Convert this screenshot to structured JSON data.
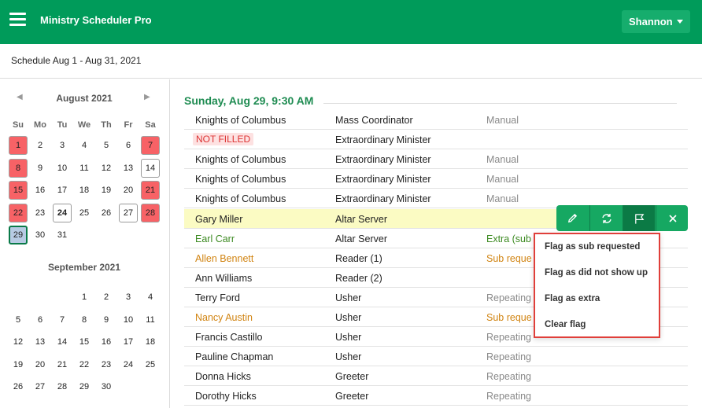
{
  "app": {
    "title": "Ministry Scheduler Pro",
    "user": "Shannon"
  },
  "subheader": {
    "title": "Schedule Aug 1 - Aug 31, 2021"
  },
  "calendar": {
    "prev_glyph": "◀",
    "next_glyph": "▶",
    "weekdays": [
      "Su",
      "Mo",
      "Tu",
      "We",
      "Th",
      "Fr",
      "Sa"
    ],
    "august": {
      "title": "August 2021",
      "days": [
        "1",
        "2",
        "3",
        "4",
        "5",
        "6",
        "7",
        "8",
        "9",
        "10",
        "11",
        "12",
        "13",
        "14",
        "15",
        "16",
        "17",
        "18",
        "19",
        "20",
        "21",
        "22",
        "23",
        "24",
        "25",
        "26",
        "27",
        "28",
        "29",
        "30",
        "31"
      ],
      "red_days": [
        "1",
        "7",
        "8",
        "15",
        "21",
        "22",
        "28"
      ],
      "outlined_days": [
        "14",
        "24",
        "27"
      ],
      "bold_days": [
        "24"
      ],
      "selected_day": "29"
    },
    "september": {
      "title": "September 2021",
      "days": [
        "1",
        "2",
        "3",
        "4",
        "5",
        "6",
        "7",
        "8",
        "9",
        "10",
        "11",
        "12",
        "13",
        "14",
        "15",
        "16",
        "17",
        "18",
        "19",
        "20",
        "21",
        "22",
        "23",
        "24",
        "25",
        "26",
        "27",
        "28",
        "29",
        "30"
      ]
    }
  },
  "schedule": {
    "heading": "Sunday, Aug 29, 9:30 AM",
    "rows": [
      {
        "name": "Knights of Columbus",
        "role": "Mass Coordinator",
        "status": "Manual"
      },
      {
        "name": "NOT FILLED",
        "role": "Extraordinary Minister",
        "status": ""
      },
      {
        "name": "Knights of Columbus",
        "role": "Extraordinary Minister",
        "status": "Manual"
      },
      {
        "name": "Knights of Columbus",
        "role": "Extraordinary Minister",
        "status": "Manual"
      },
      {
        "name": "Knights of Columbus",
        "role": "Extraordinary Minister",
        "status": "Manual"
      },
      {
        "name": "Gary Miller",
        "role": "Altar Server",
        "status": ""
      },
      {
        "name": "Earl Carr",
        "role": "Altar Server",
        "status": "Extra (sub"
      },
      {
        "name": "Allen Bennett",
        "role": "Reader (1)",
        "status": "Sub reque"
      },
      {
        "name": "Ann Williams",
        "role": "Reader (2)",
        "status": ""
      },
      {
        "name": "Terry Ford",
        "role": "Usher",
        "status": "Repeating"
      },
      {
        "name": "Nancy Austin",
        "role": "Usher",
        "status": "Sub reque"
      },
      {
        "name": "Francis Castillo",
        "role": "Usher",
        "status": "Repeating"
      },
      {
        "name": "Pauline Chapman",
        "role": "Usher",
        "status": "Repeating"
      },
      {
        "name": "Donna Hicks",
        "role": "Greeter",
        "status": "Repeating"
      },
      {
        "name": "Dorothy Hicks",
        "role": "Greeter",
        "status": "Repeating"
      }
    ]
  },
  "row_actions": {
    "icons": [
      "pencil-icon",
      "swap-icon",
      "flag-icon",
      "close-icon"
    ]
  },
  "flag_menu": {
    "items": [
      "Flag as sub requested",
      "Flag as did not show up",
      "Flag as extra",
      "Clear flag"
    ]
  },
  "colors": {
    "brand": "#009b5a",
    "heading": "#1f8c52",
    "unavailable_day": "#f76266",
    "highlight_row": "#fbfbc3",
    "menu_border": "#e03f3a"
  }
}
